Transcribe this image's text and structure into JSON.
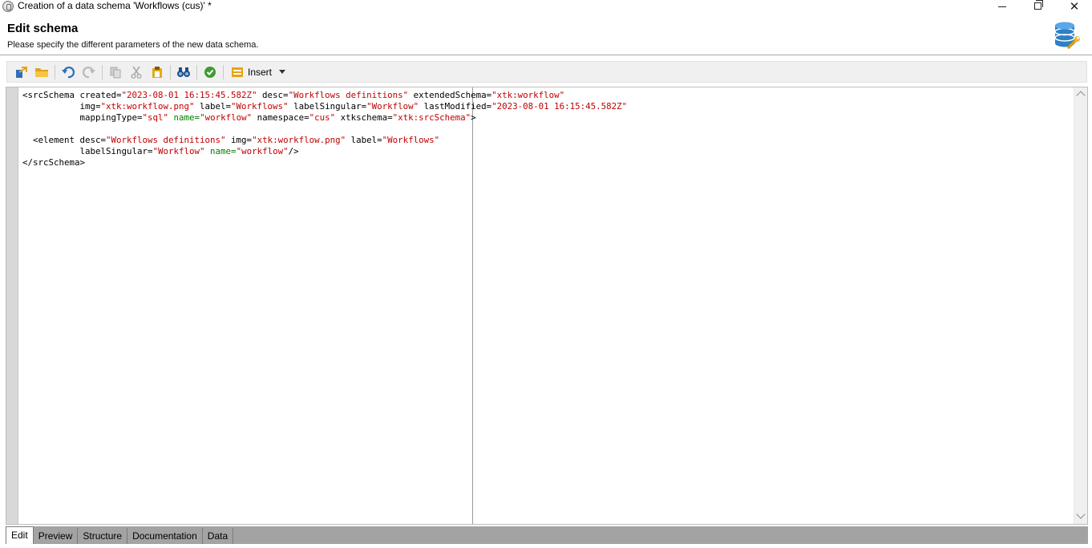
{
  "window": {
    "title": "Creation of a data schema 'Workflows (cus)' *",
    "controls": [
      "minimize",
      "restore",
      "close"
    ]
  },
  "header": {
    "title": "Edit schema",
    "subtitle": "Please specify the different parameters of the new data schema.",
    "icon": "database-wrench-icon"
  },
  "toolbar": {
    "items": [
      "new-icon",
      "open-folder-icon",
      "undo-icon",
      "redo-icon",
      "copy-icon",
      "cut-icon",
      "paste-icon",
      "find-binoculars-icon",
      "validate-check-icon"
    ],
    "insert_label": "Insert"
  },
  "editor": {
    "lines": [
      [
        {
          "t": "tag",
          "v": "<srcSchema "
        },
        {
          "t": "attr",
          "v": "created="
        },
        {
          "t": "val",
          "v": "\"2023-08-01 16:15:45.582Z\""
        },
        {
          "t": "attr",
          "v": " desc="
        },
        {
          "t": "val",
          "v": "\"Workflows definitions\""
        },
        {
          "t": "attr",
          "v": " extendedSchema="
        },
        {
          "t": "val",
          "v": "\"xtk:workflow\""
        }
      ],
      [
        {
          "t": "attr",
          "v": "           img="
        },
        {
          "t": "val",
          "v": "\"xtk:workflow.png\""
        },
        {
          "t": "attr",
          "v": " label="
        },
        {
          "t": "val",
          "v": "\"Workflows\""
        },
        {
          "t": "attr",
          "v": " labelSingular="
        },
        {
          "t": "val",
          "v": "\"Workflow\""
        },
        {
          "t": "attr",
          "v": " lastModified="
        },
        {
          "t": "val",
          "v": "\"2023-08-01 16:15:45.582Z\""
        }
      ],
      [
        {
          "t": "attr",
          "v": "           mappingType="
        },
        {
          "t": "val",
          "v": "\"sql\""
        },
        {
          "t": "attr",
          "v": " "
        },
        {
          "t": "key",
          "v": "name="
        },
        {
          "t": "val",
          "v": "\"workflow\""
        },
        {
          "t": "attr",
          "v": " namespace="
        },
        {
          "t": "val",
          "v": "\"cus\""
        },
        {
          "t": "attr",
          "v": " xtkschema="
        },
        {
          "t": "val",
          "v": "\"xtk:srcSchema\""
        },
        {
          "t": "tag",
          "v": ">"
        }
      ],
      [],
      [
        {
          "t": "tag",
          "v": "  <element "
        },
        {
          "t": "attr",
          "v": "desc="
        },
        {
          "t": "val",
          "v": "\"Workflows definitions\""
        },
        {
          "t": "attr",
          "v": " img="
        },
        {
          "t": "val",
          "v": "\"xtk:workflow.png\""
        },
        {
          "t": "attr",
          "v": " label="
        },
        {
          "t": "val",
          "v": "\"Workflows\""
        }
      ],
      [
        {
          "t": "attr",
          "v": "           labelSingular="
        },
        {
          "t": "val",
          "v": "\"Workflow\""
        },
        {
          "t": "attr",
          "v": " "
        },
        {
          "t": "key",
          "v": "name="
        },
        {
          "t": "val",
          "v": "\"workflow\""
        },
        {
          "t": "tag",
          "v": "/>"
        }
      ],
      [
        {
          "t": "tag",
          "v": "</srcSchema>"
        }
      ]
    ]
  },
  "tabs": [
    {
      "label": "Edit",
      "active": true
    },
    {
      "label": "Preview",
      "active": false
    },
    {
      "label": "Structure",
      "active": false
    },
    {
      "label": "Documentation",
      "active": false
    },
    {
      "label": "Data",
      "active": false
    }
  ]
}
